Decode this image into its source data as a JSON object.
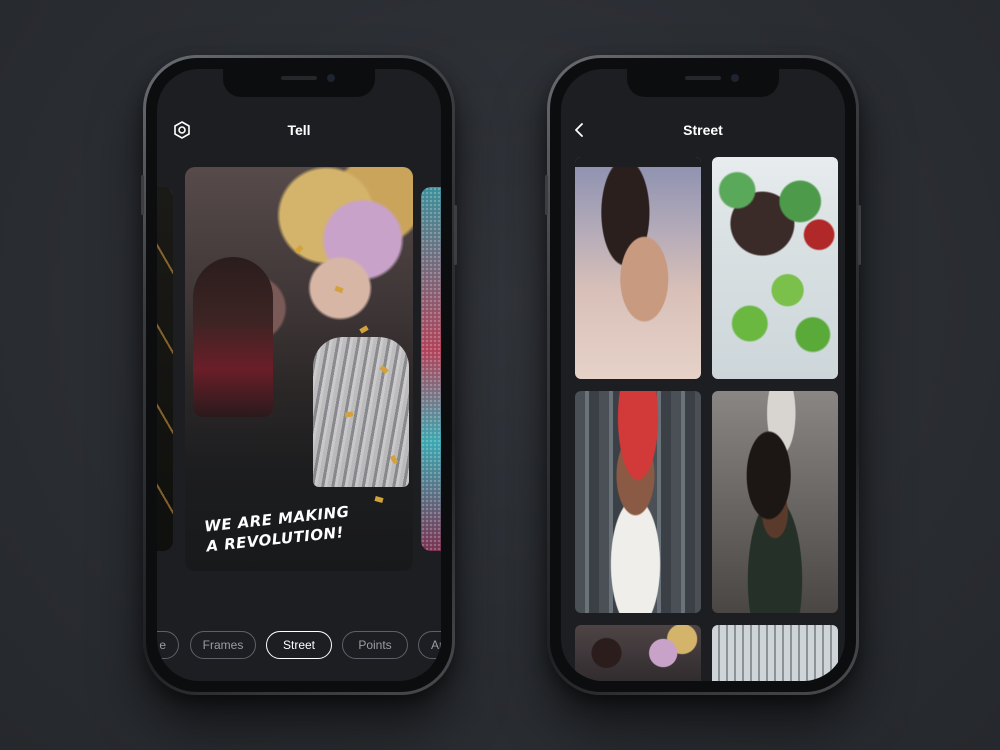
{
  "left_phone": {
    "nav": {
      "title": "Tell",
      "icon": "settings-hexagon-icon"
    },
    "carousel": {
      "active_card_caption": "WE ARE MAKING\nA REVOLUTION!"
    },
    "filters": [
      {
        "label": "e",
        "active": false
      },
      {
        "label": "Frames",
        "active": false
      },
      {
        "label": "Street",
        "active": true
      },
      {
        "label": "Points",
        "active": false
      },
      {
        "label": "Ar",
        "active": false
      }
    ]
  },
  "right_phone": {
    "nav": {
      "title": "Street",
      "icon": "back-chevron-icon"
    }
  },
  "colors": {
    "background": "#2b2e33",
    "screen": "#1c1e22",
    "chip_border": "#5d6068",
    "chip_active": "#ffffff"
  }
}
